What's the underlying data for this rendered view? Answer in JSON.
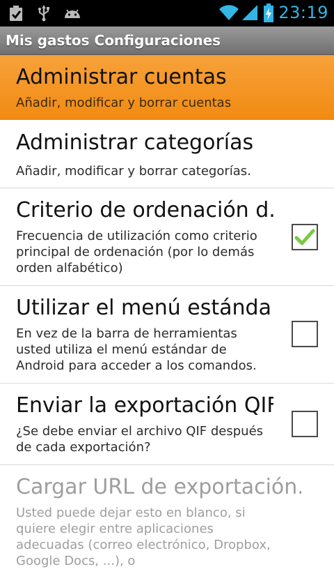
{
  "status_bar": {
    "time": "23:19",
    "icons": [
      "clipboard-check-icon",
      "usb-icon",
      "android-icon",
      "wifi-icon",
      "signal-icon",
      "battery-charging-icon"
    ]
  },
  "title_bar": {
    "title": "Mis gastos Configuraciones"
  },
  "settings": [
    {
      "title": "Administrar cuentas",
      "summary": "Añadir, modificar y borrar cuentas",
      "selected": true
    },
    {
      "title": "Administrar categorías",
      "summary": "Añadir, modificar y borrar categorías."
    },
    {
      "title": "Criterio de ordenación d..",
      "summary": "Frecuencia de utilización como criterio principal de ordenación (por lo demás orden alfabético)",
      "checked": true
    },
    {
      "title": "Utilizar el menú estánda..",
      "summary": "En vez de la barra de herramientas usted utiliza el menú estándar de Android para acceder a los comandos.",
      "checked": false
    },
    {
      "title": "Enviar la exportación QIF",
      "summary": "¿Se debe enviar el archivo QIF después de cada exportación?",
      "checked": false
    },
    {
      "title": "Cargar URL de exportación..",
      "summary": "Usted puede dejar esto en blanco, si quiere elegir entre aplicaciones adecuadas (correo electrónico, Dropbox, Google Docs, ...), o",
      "disabled": true
    }
  ],
  "colors": {
    "accent": "#33b5e5",
    "selected_row": "#f39521",
    "check_green": "#7ac943"
  }
}
